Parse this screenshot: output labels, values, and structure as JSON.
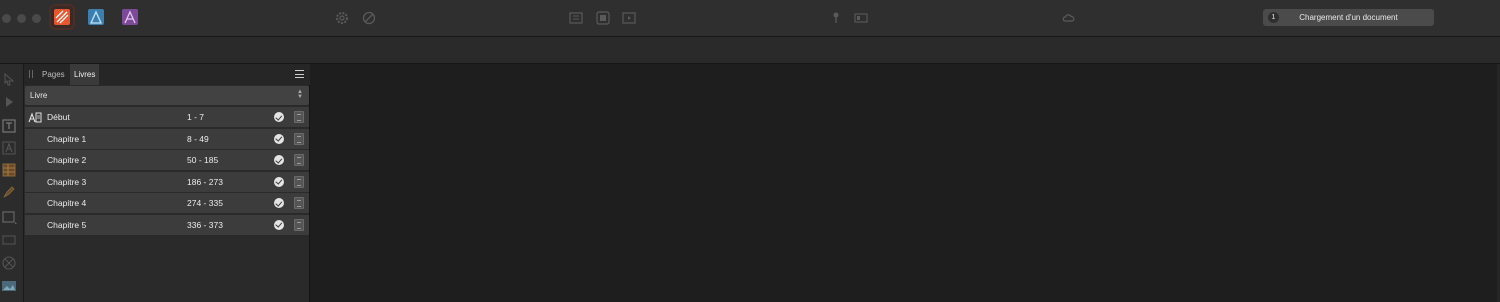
{
  "colors": {
    "toolbar": "#2f2f2f",
    "panel": "#2a2a2a",
    "row": "#3c3c3c",
    "canvas": "#1e1e1e",
    "publisher_orange": "#e8562f",
    "designer_blue": "#4aa3d8",
    "photo_purple": "#9b59b6"
  },
  "toolbar": {
    "personas": [
      "publisher-persona-icon",
      "designer-persona-icon",
      "photo-persona-icon"
    ],
    "status": {
      "count": "1",
      "text": "Chargement d'un document"
    }
  },
  "panel": {
    "tabs": [
      "Pages",
      "Livres"
    ],
    "active_tab": "Livres",
    "book_select": "Livre",
    "chapters": [
      {
        "name": "Début",
        "range": "1 - 7"
      },
      {
        "name": "Chapitre 1",
        "range": "8 - 49"
      },
      {
        "name": "Chapitre 2",
        "range": "50 - 185"
      },
      {
        "name": "Chapitre 3",
        "range": "186 - 273"
      },
      {
        "name": "Chapitre 4",
        "range": "274 - 335"
      },
      {
        "name": "Chapitre 5",
        "range": "336 - 373"
      }
    ]
  }
}
